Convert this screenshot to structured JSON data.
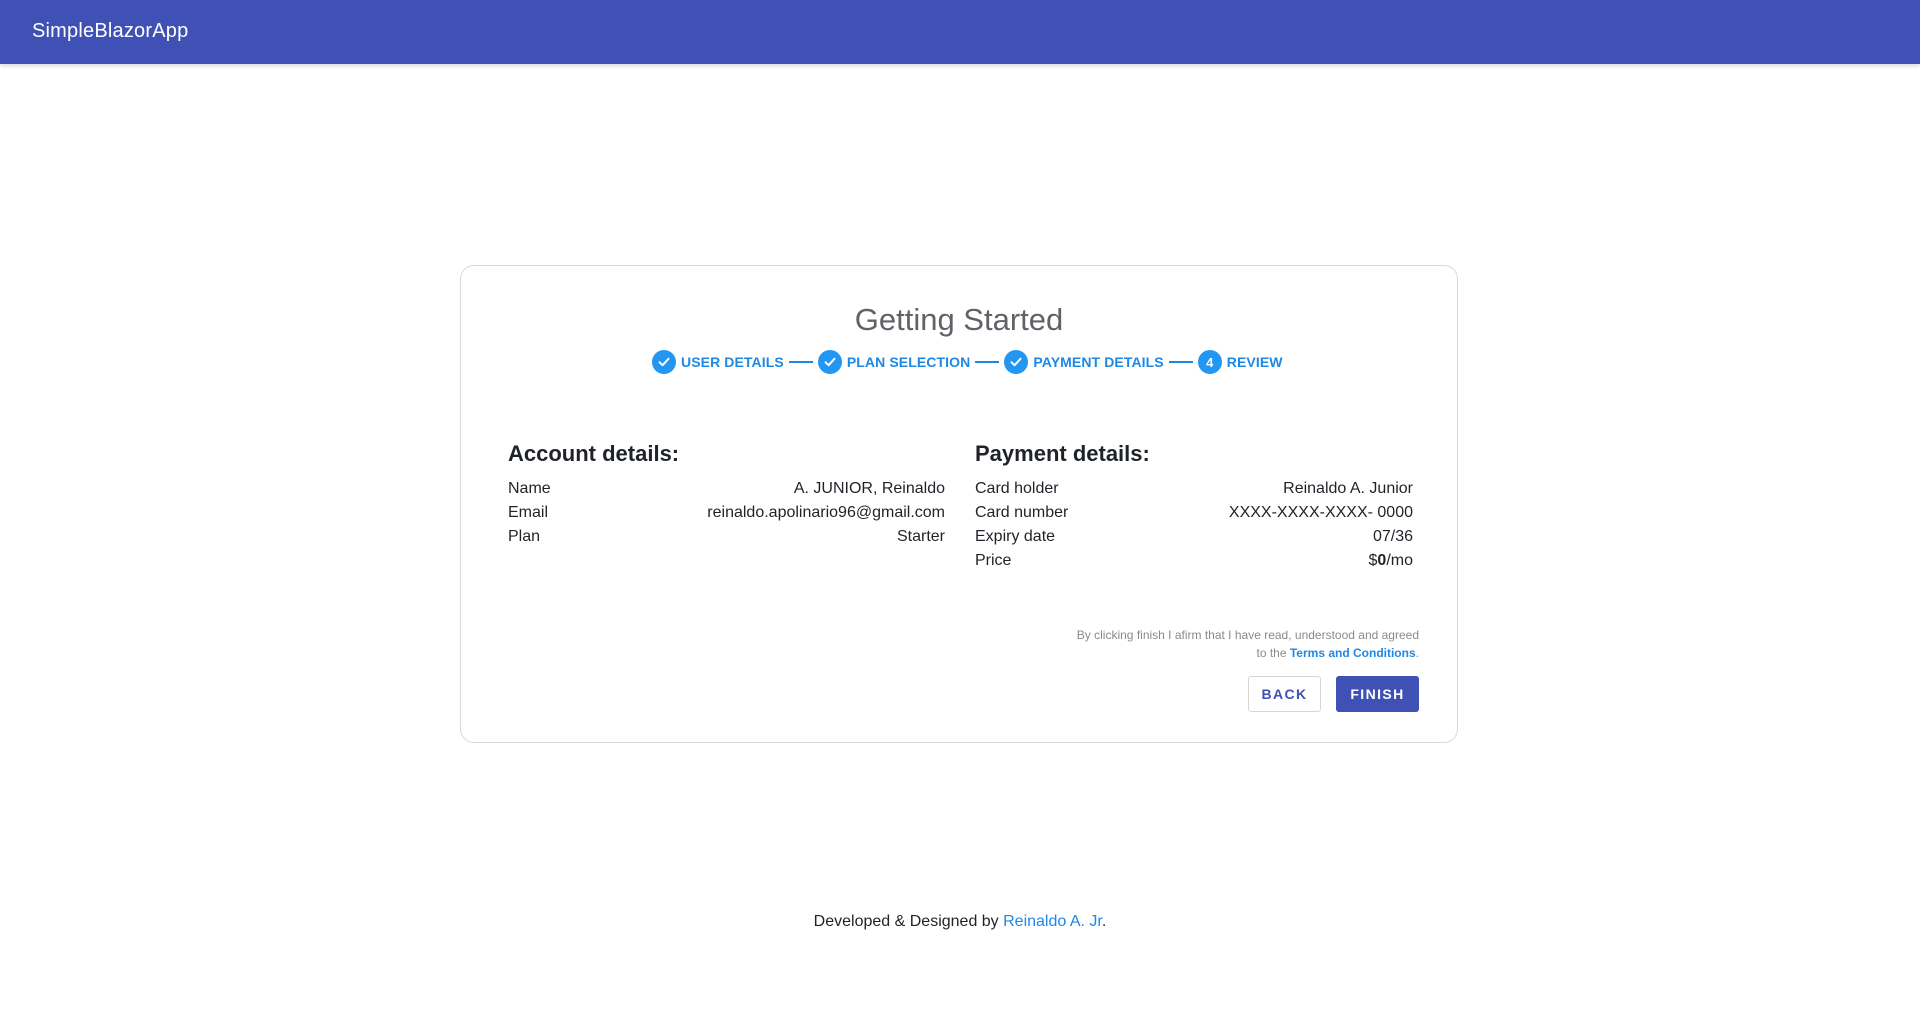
{
  "app": {
    "title": "SimpleBlazorApp"
  },
  "card": {
    "title": "Getting Started"
  },
  "stepper": {
    "steps": [
      {
        "label": "USER DETAILS",
        "state": "complete",
        "icon": "check-icon"
      },
      {
        "label": "PLAN SELECTION",
        "state": "complete",
        "icon": "check-icon"
      },
      {
        "label": "PAYMENT DETAILS",
        "state": "complete",
        "icon": "check-icon"
      },
      {
        "label": "REVIEW",
        "state": "active",
        "number": "4"
      }
    ]
  },
  "account": {
    "heading": "Account details:",
    "rows": [
      {
        "label": "Name",
        "value": "A. JUNIOR, Reinaldo"
      },
      {
        "label": "Email",
        "value": "reinaldo.apolinario96@gmail.com"
      },
      {
        "label": "Plan",
        "value": "Starter"
      }
    ]
  },
  "payment": {
    "heading": "Payment details:",
    "rows": [
      {
        "label": "Card holder",
        "value": "Reinaldo A. Junior"
      },
      {
        "label": "Card number",
        "value": "XXXX-XXXX-XXXX- 0000"
      },
      {
        "label": "Expiry date",
        "value": "07/36"
      }
    ],
    "price": {
      "label": "Price",
      "currency": "$",
      "amount": "0",
      "period": "/mo"
    }
  },
  "terms": {
    "text_before": "By clicking finish I afirm that I have read, understood and agreed",
    "text_to": "to the ",
    "link": "Terms and Conditions",
    "text_after": "."
  },
  "actions": {
    "back_label": "BACK",
    "finish_label": "FINISH"
  },
  "footer": {
    "text": "Developed & Designed by ",
    "author": "Reinaldo A. Jr",
    "suffix": "."
  },
  "colors": {
    "appbar": "#3f51b5",
    "accent": "#2196f3",
    "link": "#1e88e5"
  }
}
